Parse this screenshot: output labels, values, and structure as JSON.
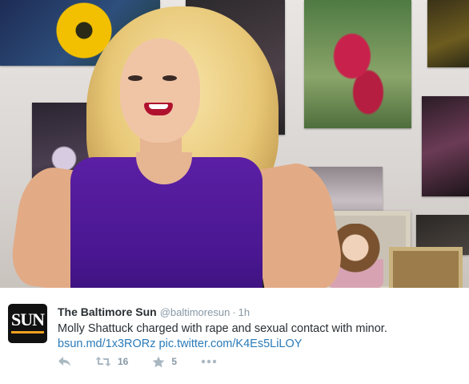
{
  "tweet": {
    "avatar_text": "SUN",
    "author_name": "The Baltimore Sun",
    "author_handle": "@baltimoresun",
    "separator": "·",
    "timestamp": "1h",
    "text": "Molly Shattuck charged with rape and sexual contact with minor.",
    "link1": "bsun.md/1x3RORz",
    "link2": "pic.twitter.com/K4Es5LiLOY",
    "retweet_count": "16",
    "favorite_count": "5"
  },
  "icons": [
    "reply-icon",
    "retweet-icon",
    "favorite-icon",
    "more-icon"
  ],
  "colors": {
    "link": "#2b7bb9",
    "name": "#292f33",
    "muted": "#8899a6",
    "action_icon": "#aab8c2",
    "dress_purple": "#4a1791"
  }
}
